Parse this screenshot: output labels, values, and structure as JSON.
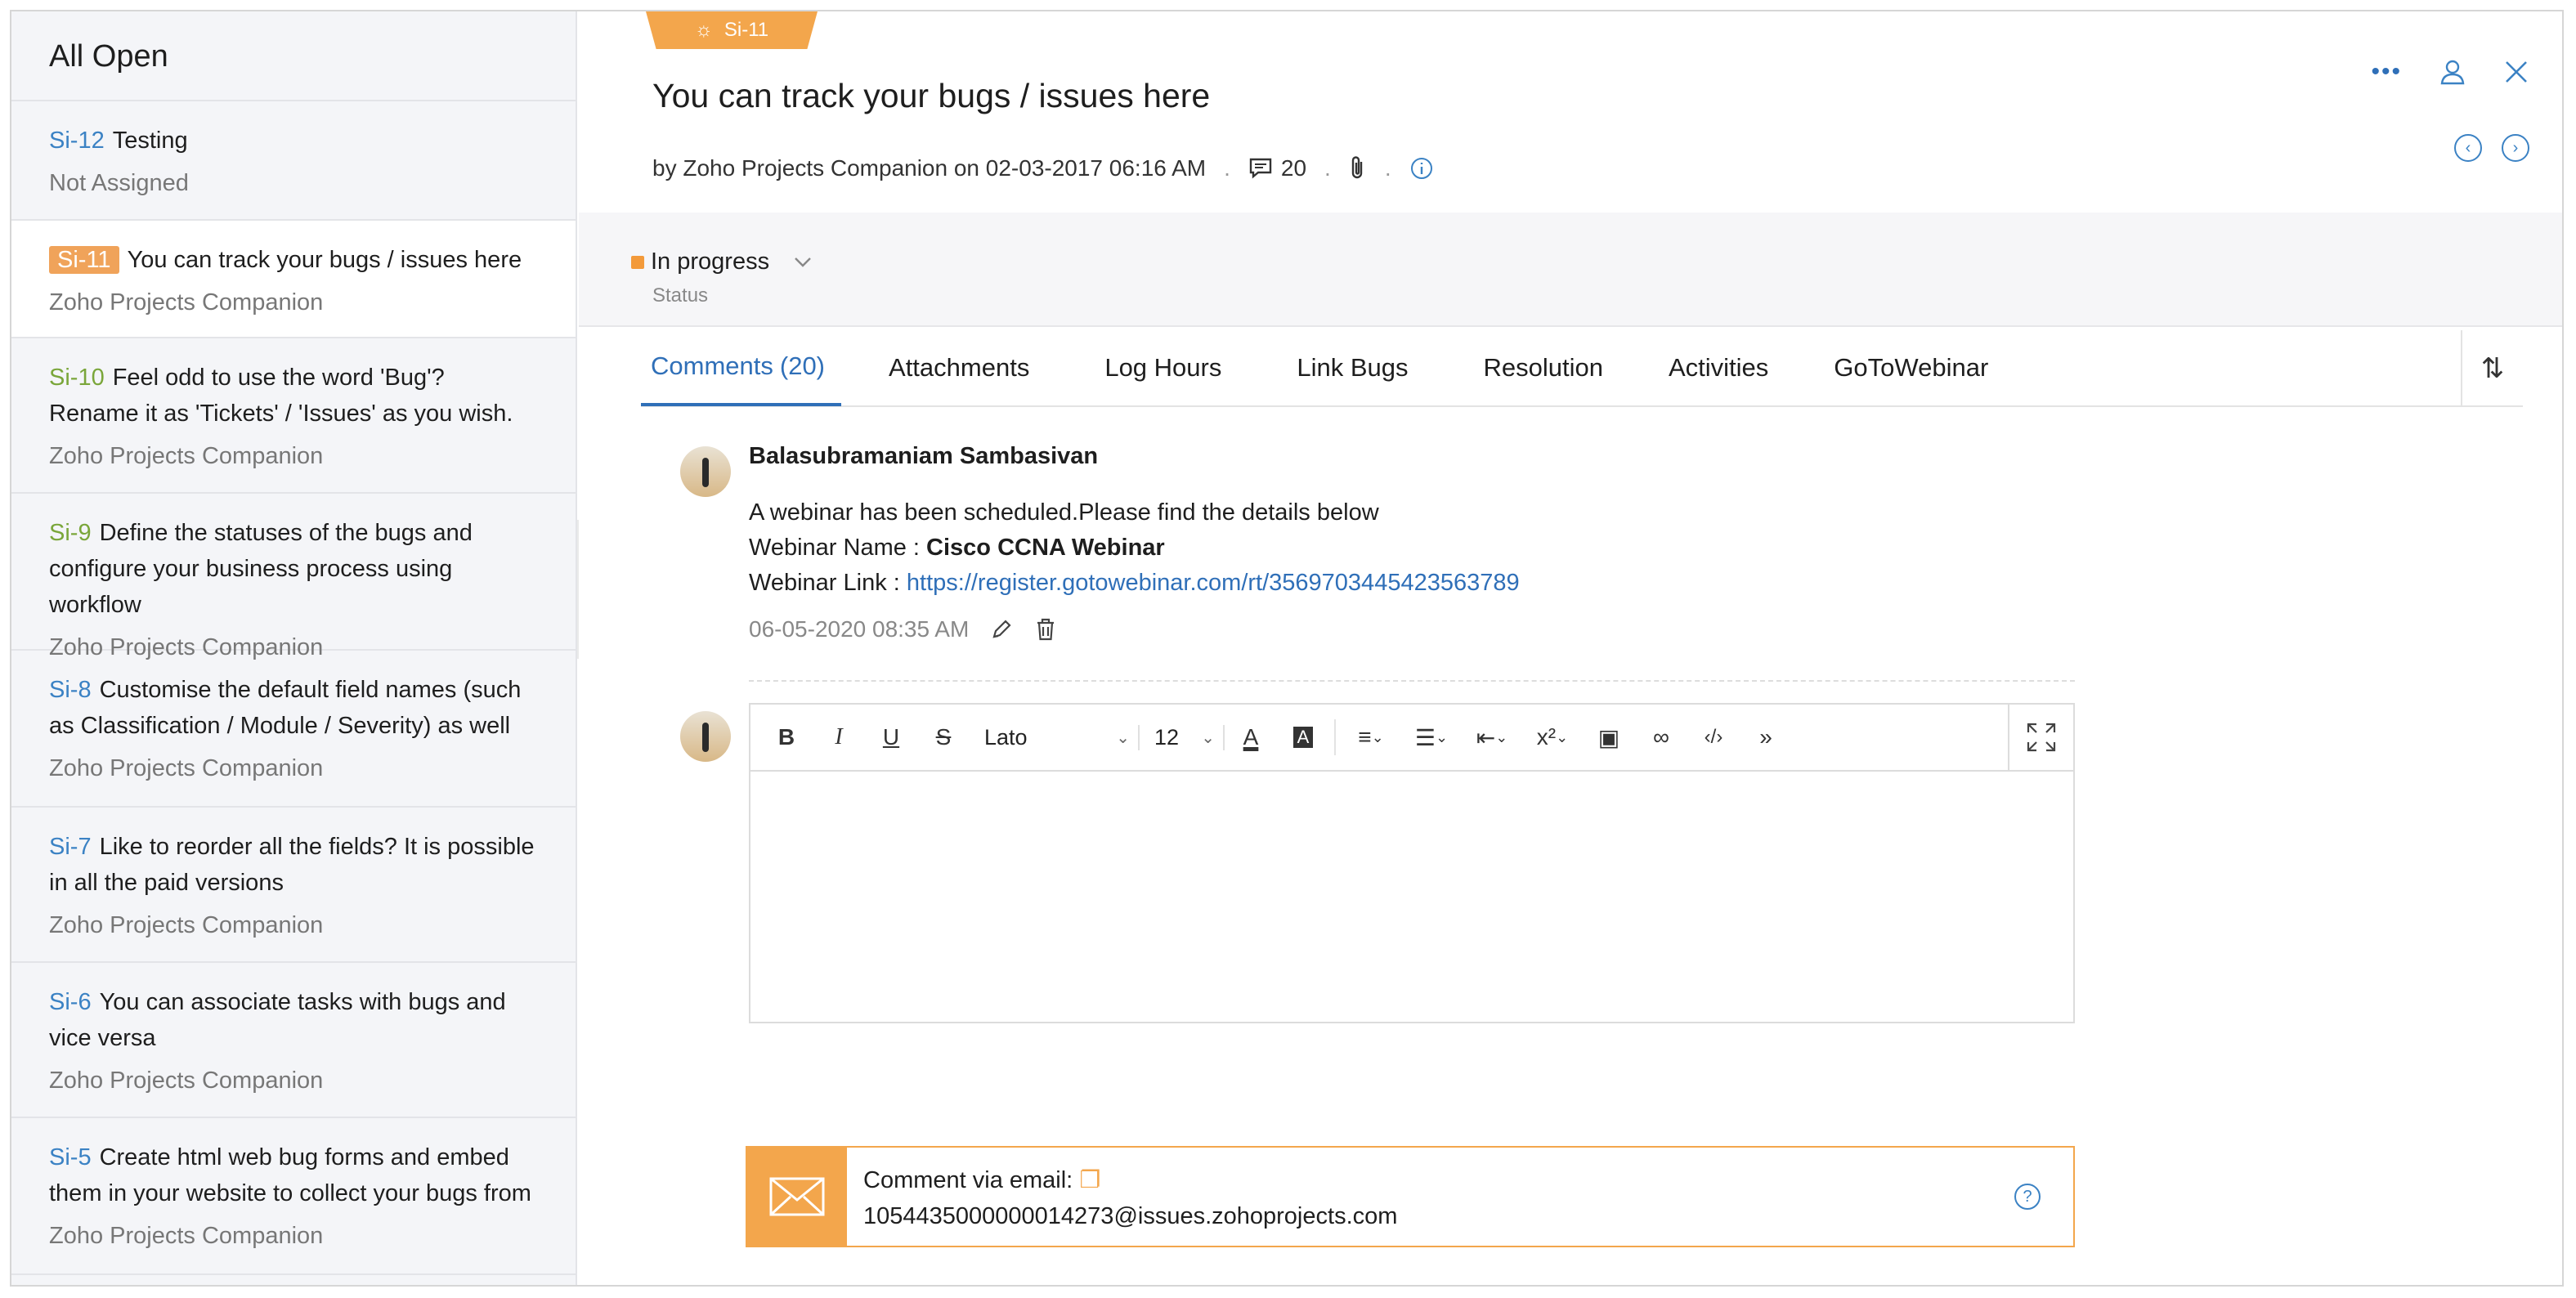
{
  "sidebar": {
    "title": "All Open",
    "items": [
      {
        "key": "Si-12",
        "title": "Testing",
        "sub": "Not Assigned",
        "style": "blue"
      },
      {
        "key": "Si-11",
        "title": "You can track your bugs / issues here",
        "sub": "Zoho Projects Companion",
        "style": "badge"
      },
      {
        "key": "Si-10",
        "title": "Feel odd to use the word 'Bug'? Rename it as 'Tickets' / 'Issues' as you wish.",
        "sub": "Zoho Projects Companion",
        "style": "green"
      },
      {
        "key": "Si-9",
        "title": "Define the statuses of the bugs and configure your business process using workflow",
        "sub": "Zoho Projects Companion",
        "style": "green"
      },
      {
        "key": "Si-8",
        "title": "Customise the default field names (such as Classification / Module / Severity) as well as its",
        "sub": "Zoho Projects Companion",
        "style": "blue"
      },
      {
        "key": "Si-7",
        "title": "Like to reorder all the fields? It is possible in all the paid versions",
        "sub": "Zoho Projects Companion",
        "style": "blue"
      },
      {
        "key": "Si-6",
        "title": "You can associate tasks with bugs and vice versa",
        "sub": "Zoho Projects Companion",
        "style": "blue"
      },
      {
        "key": "Si-5",
        "title": "Create html web bug forms and embed them in your website to collect your bugs from",
        "sub": "Zoho Projects Companion",
        "style": "blue"
      }
    ]
  },
  "issue": {
    "tag": "Si-11",
    "title": "You can track your bugs / issues here",
    "meta_by": "by Zoho Projects Companion on 02-03-2017 06:16 AM",
    "comment_count": "20",
    "status_value": "In progress",
    "status_label": "Status"
  },
  "tabs": [
    {
      "label": "Comments",
      "count": "(20)"
    },
    {
      "label": "Attachments"
    },
    {
      "label": "Log Hours"
    },
    {
      "label": "Link Bugs"
    },
    {
      "label": "Resolution"
    },
    {
      "label": "Activities"
    },
    {
      "label": "GoToWebinar"
    }
  ],
  "comment": {
    "author": "Balasubramaniam Sambasivan",
    "line1": "A webinar has been scheduled.Please find the details below",
    "name_label": "Webinar Name : ",
    "name_value": "Cisco CCNA Webinar",
    "link_label": "Webinar Link : ",
    "link_value": "https://register.gotowebinar.com/rt/3569703445423563789",
    "time": "06-05-2020 08:35 AM"
  },
  "editor": {
    "font": "Lato",
    "size": "12"
  },
  "email": {
    "label": "Comment via email:",
    "address": "1054435000000014273@issues.zohoprojects.com"
  },
  "colors": {
    "accent": "#2f6fb8",
    "orange": "#f3a64c",
    "green": "#7aa63a"
  }
}
